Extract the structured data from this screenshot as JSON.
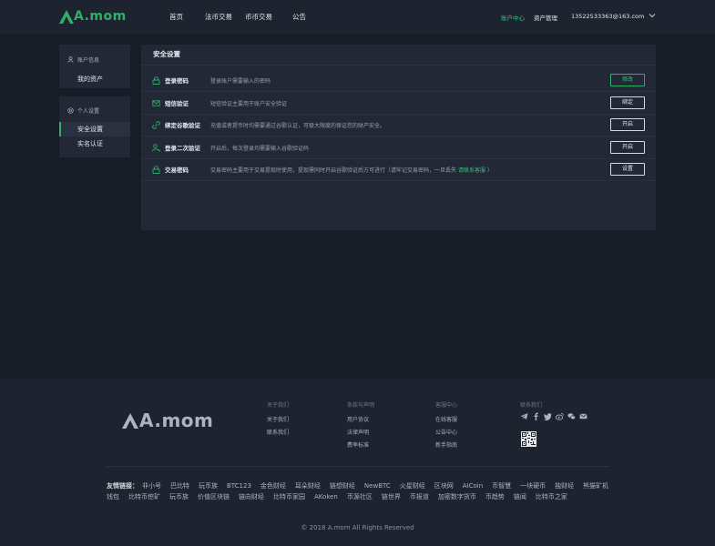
{
  "brand": {
    "name": "A.mom",
    "color": "#2fb06a"
  },
  "nav": {
    "items": [
      "首页",
      "法币交易",
      "币币交易",
      "公告"
    ]
  },
  "header": {
    "account_center": "账户中心",
    "asset_manage": "资产管理",
    "email": "13522533363@163.com"
  },
  "sidebar": {
    "group1": {
      "title": "账户信息",
      "items": [
        "我的资产"
      ]
    },
    "group2": {
      "title": "个人设置",
      "items": [
        "安全设置",
        "实名认证"
      ]
    }
  },
  "security": {
    "title": "安全设置",
    "rows": [
      {
        "icon": "lock-icon",
        "label": "登录密码",
        "desc": "登录账户需要输入的密码",
        "button": "修改"
      },
      {
        "icon": "mail-icon",
        "label": "短信验证",
        "desc": "短信验证主要用于账户安全验证",
        "button": "绑定"
      },
      {
        "icon": "link-icon",
        "label": "绑定谷歌验证",
        "desc": "充值或者提币时均需要通过谷歌认证，可极大限度的保证您的财产安全。",
        "button": "开启"
      },
      {
        "icon": "user-key-icon",
        "label": "登录二次验证",
        "desc": "开启后，每次登录均需要输入谷歌验证码",
        "button": "开启"
      },
      {
        "icon": "lock-icon",
        "label": "交易密码",
        "desc": "交易密码主要用于交易提现时使用，提现需同时开启谷歌验证后方可进行（请牢记交易密码，一旦丢失",
        "desc_link": "请联系客服",
        "desc_end": "）",
        "button": "设置"
      }
    ]
  },
  "footer": {
    "col1": {
      "title": "关于我们",
      "items": [
        "关于我们",
        "联系我们"
      ]
    },
    "col2": {
      "title": "条款与声明",
      "items": [
        "用户协议",
        "法律声明",
        "费率标准"
      ]
    },
    "col3": {
      "title": "客服中心",
      "items": [
        "在线客服",
        "公告中心",
        "新手指南"
      ]
    },
    "col4": {
      "title": "联系我们"
    },
    "friend_label": "友情链接：",
    "links_row1": [
      "非小号",
      "巴比特",
      "玩币族",
      "BTC123",
      "金色财经",
      "耳朵财经",
      "链想财经",
      "NewBTC",
      "火星财经",
      "区块网",
      "AICoin",
      "币智慧",
      "一块硬币",
      "独财经",
      "熊猫矿机"
    ],
    "links_row2": [
      "钱包",
      "比特币挖矿",
      "玩币族",
      "价值区块链",
      "链向财经",
      "比特币家园",
      "AKoken",
      "币源社区",
      "链世界",
      "币报道",
      "加密数字货币",
      "币趋势",
      "链闻",
      "比特币之家"
    ],
    "copyright": "© 2018 A.mom All Rights Reserved"
  }
}
